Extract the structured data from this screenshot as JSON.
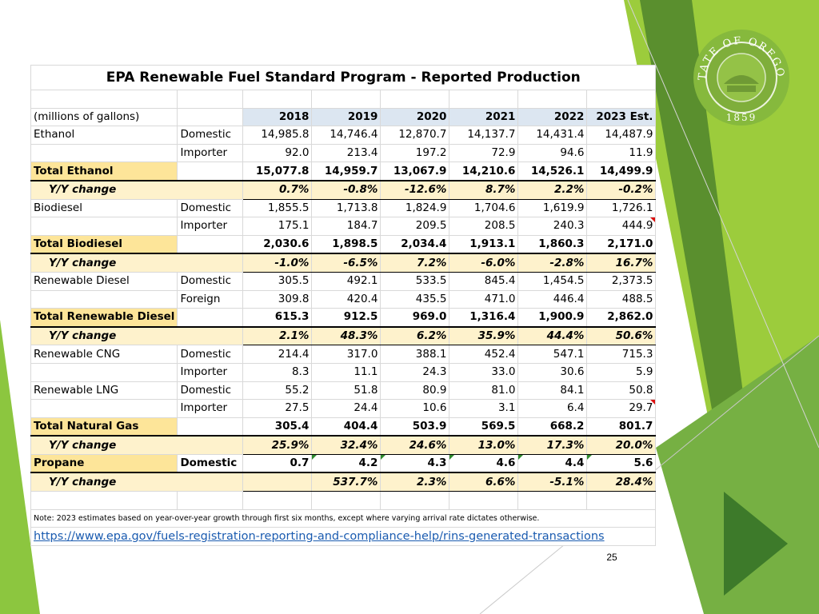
{
  "title": "EPA Renewable Fuel Standard Program - Reported Production",
  "units_label": "(millions of gallons)",
  "years": [
    "2018",
    "2019",
    "2020",
    "2021",
    "2022",
    "2023 Est."
  ],
  "rows": [
    {
      "kind": "data",
      "fuel": "Ethanol",
      "source": "Domestic",
      "values": [
        "14,985.8",
        "14,746.4",
        "12,870.7",
        "14,137.7",
        "14,431.4",
        "14,487.9"
      ]
    },
    {
      "kind": "data",
      "fuel": "",
      "source": "Importer",
      "values": [
        "92.0",
        "213.4",
        "197.2",
        "72.9",
        "94.6",
        "11.9"
      ]
    },
    {
      "kind": "total",
      "fuel": "Total Ethanol",
      "source": "",
      "values": [
        "15,077.8",
        "14,959.7",
        "13,067.9",
        "14,210.6",
        "14,526.1",
        "14,499.9"
      ]
    },
    {
      "kind": "yy",
      "fuel": "Y/Y change",
      "source": "",
      "values": [
        "0.7%",
        "-0.8%",
        "-12.6%",
        "8.7%",
        "2.2%",
        "-0.2%"
      ]
    },
    {
      "kind": "data",
      "fuel": "Biodiesel",
      "source": "Domestic",
      "values": [
        "1,855.5",
        "1,713.8",
        "1,824.9",
        "1,704.6",
        "1,619.9",
        "1,726.1"
      ]
    },
    {
      "kind": "data",
      "fuel": "",
      "source": "Importer",
      "values": [
        "175.1",
        "184.7",
        "209.5",
        "208.5",
        "240.3",
        "444.9"
      ]
    },
    {
      "kind": "total",
      "fuel": "Total Biodiesel",
      "source": "",
      "values": [
        "2,030.6",
        "1,898.5",
        "2,034.4",
        "1,913.1",
        "1,860.3",
        "2,171.0"
      ]
    },
    {
      "kind": "yy",
      "fuel": "Y/Y change",
      "source": "",
      "values": [
        "-1.0%",
        "-6.5%",
        "7.2%",
        "-6.0%",
        "-2.8%",
        "16.7%"
      ]
    },
    {
      "kind": "data",
      "fuel": "Renewable Diesel",
      "source": "Domestic",
      "values": [
        "305.5",
        "492.1",
        "533.5",
        "845.4",
        "1,454.5",
        "2,373.5"
      ]
    },
    {
      "kind": "data",
      "fuel": "",
      "source": "Foreign",
      "values": [
        "309.8",
        "420.4",
        "435.5",
        "471.0",
        "446.4",
        "488.5"
      ]
    },
    {
      "kind": "total",
      "fuel": "Total Renewable Diesel",
      "source": "",
      "values": [
        "615.3",
        "912.5",
        "969.0",
        "1,316.4",
        "1,900.9",
        "2,862.0"
      ]
    },
    {
      "kind": "yy",
      "fuel": "Y/Y change",
      "source": "",
      "values": [
        "2.1%",
        "48.3%",
        "6.2%",
        "35.9%",
        "44.4%",
        "50.6%"
      ]
    },
    {
      "kind": "data",
      "fuel": "Renewable CNG",
      "source": "Domestic",
      "values": [
        "214.4",
        "317.0",
        "388.1",
        "452.4",
        "547.1",
        "715.3"
      ]
    },
    {
      "kind": "data",
      "fuel": "",
      "source": "Importer",
      "values": [
        "8.3",
        "11.1",
        "24.3",
        "33.0",
        "30.6",
        "5.9"
      ]
    },
    {
      "kind": "data",
      "fuel": "Renewable LNG",
      "source": "Domestic",
      "values": [
        "55.2",
        "51.8",
        "80.9",
        "81.0",
        "84.1",
        "50.8"
      ]
    },
    {
      "kind": "data",
      "fuel": "",
      "source": "Importer",
      "values": [
        "27.5",
        "24.4",
        "10.6",
        "3.1",
        "6.4",
        "29.7"
      ]
    },
    {
      "kind": "total",
      "fuel": "Total Natural Gas",
      "source": "",
      "values": [
        "305.4",
        "404.4",
        "503.9",
        "569.5",
        "668.2",
        "801.7"
      ]
    },
    {
      "kind": "yy",
      "fuel": "Y/Y change",
      "source": "",
      "values": [
        "25.9%",
        "32.4%",
        "24.6%",
        "13.0%",
        "17.3%",
        "20.0%"
      ]
    },
    {
      "kind": "total",
      "fuel": "Propane",
      "source": "Domestic",
      "values": [
        "0.7",
        "4.2",
        "4.3",
        "4.6",
        "4.4",
        "5.6"
      ]
    },
    {
      "kind": "yy",
      "fuel": "Y/Y change",
      "source": "",
      "values": [
        "",
        "537.7%",
        "2.3%",
        "6.6%",
        "-5.1%",
        "28.4%"
      ]
    }
  ],
  "note": "Note: 2023 estimates based on year-over-year growth through first six months, except where varying arrival rate dictates otherwise.",
  "link": "https://www.epa.gov/fuels-registration-reporting-and-compliance-help/rins-generated-transactions",
  "seal": {
    "top_text": "STATE OF OREGON",
    "year": "1859"
  },
  "page_number": "25",
  "colors": {
    "header_fill": "#dce6f1",
    "total_label_fill": "#fde599",
    "yoy_fill": "#fef2cc",
    "link": "#1a5bb0",
    "accent_green_dark": "#4e8a2b",
    "accent_green_light": "#9ccc3c"
  }
}
